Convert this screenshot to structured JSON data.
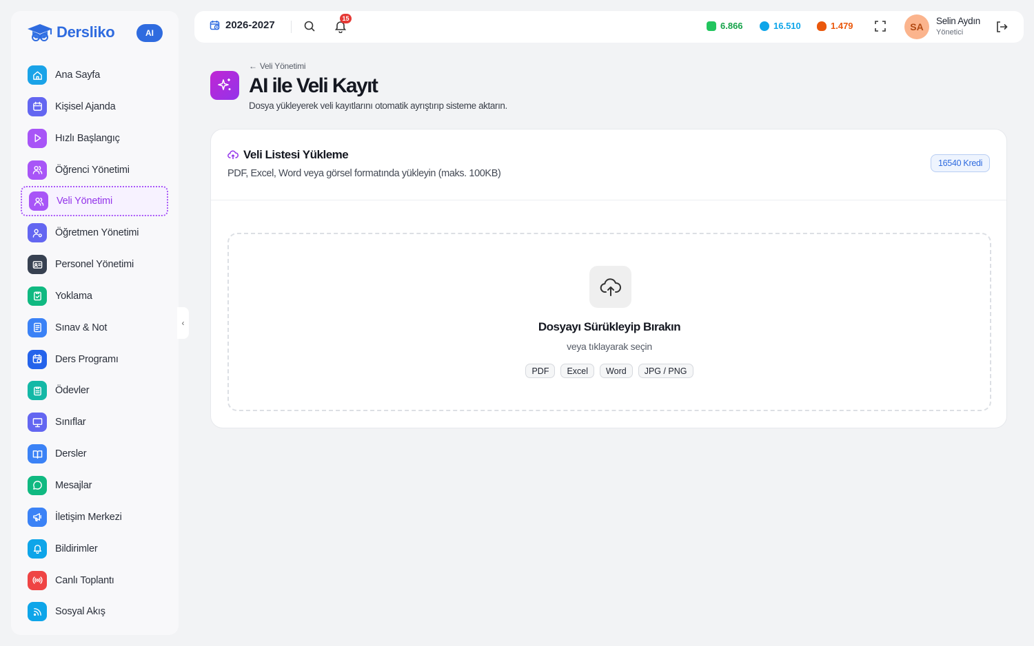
{
  "app": {
    "name": "Dersliko",
    "ai_badge": "AI"
  },
  "sidebar": {
    "items": [
      {
        "label": "Ana Sayfa",
        "icon": "home-icon",
        "color": "#1aa3e8"
      },
      {
        "label": "Kişisel Ajanda",
        "icon": "calendar-icon",
        "color": "#6366f1"
      },
      {
        "label": "Hızlı Başlangıç",
        "icon": "play-icon",
        "color": "#a855f7"
      },
      {
        "label": "Öğrenci Yönetimi",
        "icon": "users-icon",
        "color": "#a855f7"
      },
      {
        "label": "Veli Yönetimi",
        "icon": "users-icon",
        "color": "#a855f7",
        "active": true
      },
      {
        "label": "Öğretmen Yönetimi",
        "icon": "teacher-icon",
        "color": "#6366f1"
      },
      {
        "label": "Personel Yönetimi",
        "icon": "id-card-icon",
        "color": "#374151"
      },
      {
        "label": "Yoklama",
        "icon": "clipboard-check-icon",
        "color": "#10b981"
      },
      {
        "label": "Sınav & Not",
        "icon": "exam-icon",
        "color": "#3b82f6"
      },
      {
        "label": "Ders Programı",
        "icon": "calendar-clock-icon",
        "color": "#2563eb"
      },
      {
        "label": "Ödevler",
        "icon": "clipboard-icon",
        "color": "#14b8a6"
      },
      {
        "label": "Sınıflar",
        "icon": "presentation-icon",
        "color": "#6366f1"
      },
      {
        "label": "Dersler",
        "icon": "book-icon",
        "color": "#3b82f6"
      },
      {
        "label": "Mesajlar",
        "icon": "message-icon",
        "color": "#10b981"
      },
      {
        "label": "İletişim Merkezi",
        "icon": "megaphone-icon",
        "color": "#3b82f6"
      },
      {
        "label": "Bildirimler",
        "icon": "bell-icon",
        "color": "#0ea5e9"
      },
      {
        "label": "Canlı Toplantı",
        "icon": "broadcast-icon",
        "color": "#ef4444"
      },
      {
        "label": "Sosyal Akış",
        "icon": "rss-icon",
        "color": "#0ea5e9"
      }
    ]
  },
  "header": {
    "year": "2026-2027",
    "notification_count": "15",
    "stats": [
      {
        "value": "6.866",
        "color": "#16a34a"
      },
      {
        "value": "16.510",
        "color": "#0ea5e9"
      },
      {
        "value": "1.479",
        "color": "#ea580c"
      }
    ],
    "user": {
      "initials": "SA",
      "name": "Selin Aydın",
      "role": "Yönetici"
    }
  },
  "page": {
    "back_label": "Veli Yönetimi",
    "title": "AI ile Veli Kayıt",
    "subtitle": "Dosya yükleyerek veli kayıtlarını otomatik ayrıştırıp sisteme aktarın."
  },
  "upload_card": {
    "title": "Veli Listesi Yükleme",
    "subtitle": "PDF, Excel, Word veya görsel formatında yükleyin (maks. 100KB)",
    "credit": "16540 Kredi",
    "drop_title": "Dosyayı Sürükleyip Bırakın",
    "drop_subtitle": "veya tıklayarak seçin",
    "formats": [
      "PDF",
      "Excel",
      "Word",
      "JPG / PNG"
    ]
  }
}
